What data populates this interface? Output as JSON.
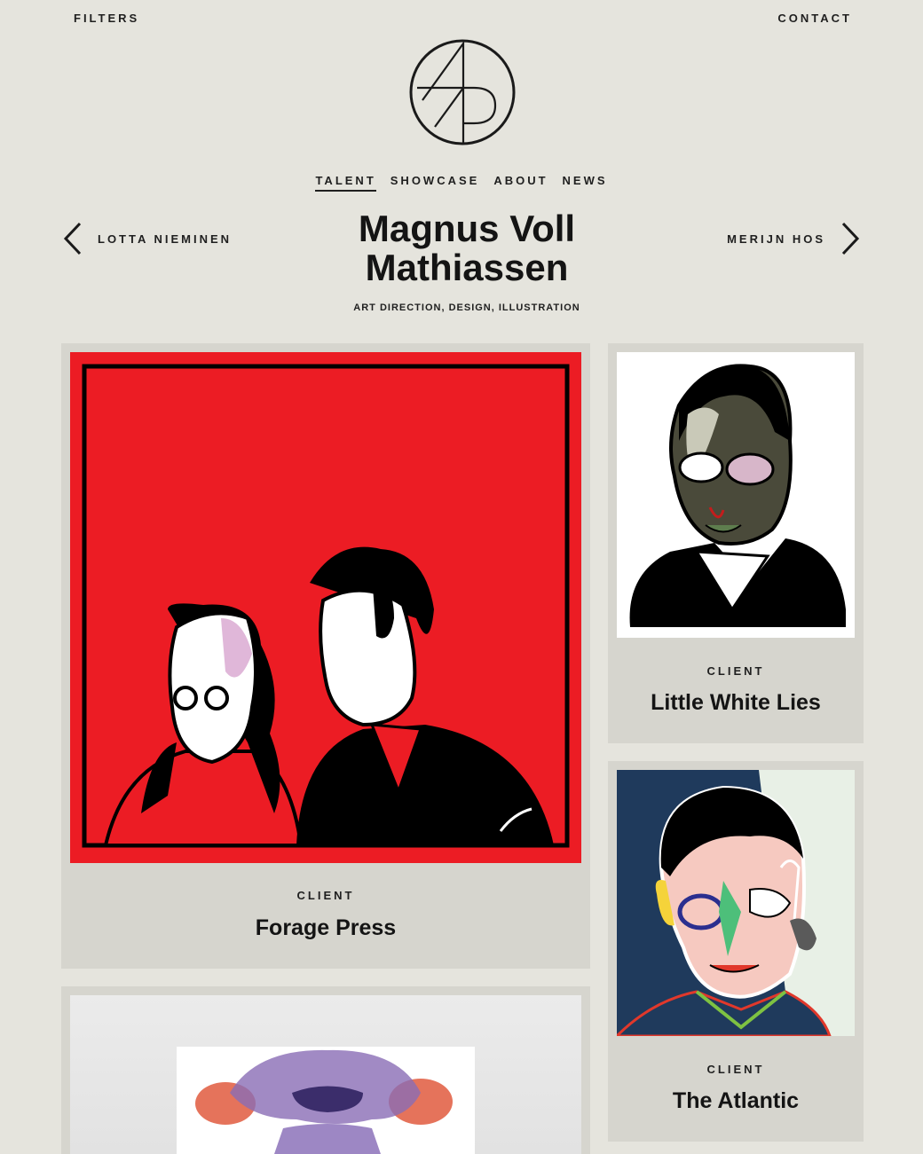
{
  "header": {
    "filters_label": "FILTERS",
    "contact_label": "CONTACT",
    "logo_text": "AP"
  },
  "nav": {
    "items": [
      {
        "label": "TALENT",
        "active": true
      },
      {
        "label": "SHOWCASE",
        "active": false
      },
      {
        "label": "ABOUT",
        "active": false
      },
      {
        "label": "NEWS",
        "active": false
      }
    ]
  },
  "artist": {
    "name_line1": "Magnus Voll",
    "name_line2": "Mathiassen",
    "disciplines": "ART DIRECTION, DESIGN, ILLUSTRATION",
    "prev": "LOTTA NIEMINEN",
    "next": "MERIJN HOS"
  },
  "projects": [
    {
      "client_label": "CLIENT",
      "client": "Forage Press"
    },
    {
      "client_label": "CLIENT",
      "client": "Little White Lies"
    },
    {
      "client_label": "CLIENT",
      "client": "The Atlantic"
    }
  ],
  "icons": [
    "left-chevron-icon",
    "right-chevron-icon"
  ],
  "colors": {
    "background": "#e5e4dd",
    "card": "#d6d5ce",
    "forage_red": "#ec1c24",
    "atlantic_navy": "#1f3a5c"
  }
}
